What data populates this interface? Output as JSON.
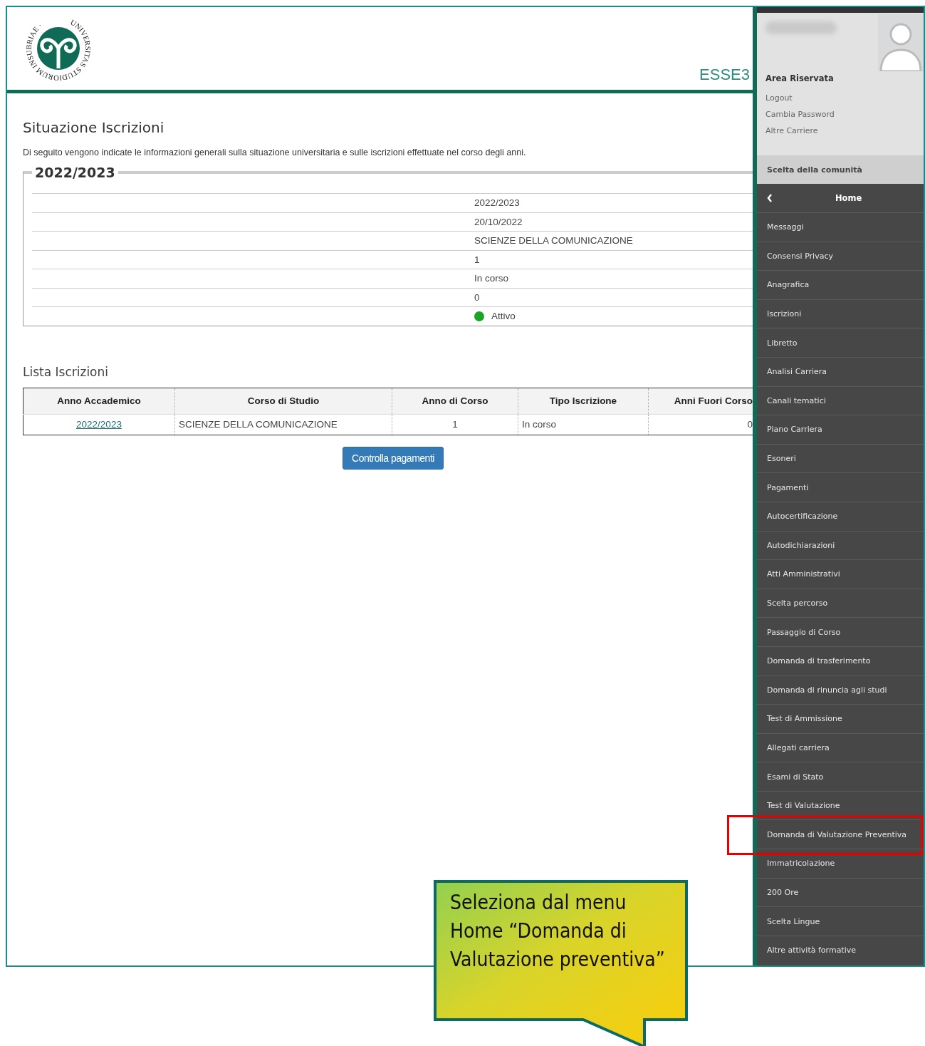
{
  "header": {
    "logo_motto": "UNIVERSITAS STUDIORUM INSUBRIAE ·",
    "app_name": "ESSE3"
  },
  "page": {
    "title": "Situazione Iscrizioni",
    "intro": "Di seguito vengono indicate le informazioni generali sulla situazione universitaria e sulle iscrizioni effettuate nel corso degli anni.",
    "year_box": {
      "legend": "2022/2023",
      "rows": [
        {
          "value": "2022/2023"
        },
        {
          "value": "20/10/2022"
        },
        {
          "value": "SCIENZE DELLA COMUNICAZIONE"
        },
        {
          "value": "1"
        },
        {
          "value": "In corso"
        },
        {
          "value": "0"
        },
        {
          "value": "Attivo",
          "color": "#1aa526"
        }
      ]
    },
    "list_title": "Lista Iscrizioni",
    "table": {
      "columns": [
        "Anno Accademico",
        "Corso di Studio",
        "Anno di Corso",
        "Tipo Iscrizione",
        "Anni Fuori Corso"
      ],
      "rows": [
        [
          "2022/2023",
          "SCIENZE DELLA COMUNICAZIONE",
          "1",
          "In corso",
          "0"
        ]
      ]
    },
    "button": "Controlla pagamenti"
  },
  "sidebar": {
    "area_title": "Area Riservata",
    "links": [
      "Logout",
      "Cambia Password",
      "Altre Carriere"
    ],
    "community": "Scelta della comunità",
    "menu_title": "Home",
    "items": [
      {
        "label": "Messaggi",
        "highlighted": false
      },
      {
        "label": "Consensi Privacy",
        "highlighted": false
      },
      {
        "label": "Anagrafica",
        "highlighted": false
      },
      {
        "label": "Iscrizioni",
        "highlighted": false
      },
      {
        "label": "Libretto",
        "highlighted": false
      },
      {
        "label": "Analisi Carriera",
        "highlighted": false
      },
      {
        "label": "Canali tematici",
        "highlighted": false
      },
      {
        "label": "Piano Carriera",
        "highlighted": false
      },
      {
        "label": "Esoneri",
        "highlighted": false
      },
      {
        "label": "Pagamenti",
        "highlighted": false
      },
      {
        "label": "Autocertificazione",
        "highlighted": false
      },
      {
        "label": "Autodichiarazioni",
        "highlighted": false
      },
      {
        "label": "Atti Amministrativi",
        "highlighted": false
      },
      {
        "label": "Scelta percorso",
        "highlighted": false
      },
      {
        "label": "Passaggio di Corso",
        "highlighted": false
      },
      {
        "label": "Domanda di trasferimento",
        "highlighted": false
      },
      {
        "label": "Domanda di rinuncia agli studi",
        "highlighted": false
      },
      {
        "label": "Test di Ammissione",
        "highlighted": false
      },
      {
        "label": "Allegati carriera",
        "highlighted": false
      },
      {
        "label": "Esami di Stato",
        "highlighted": false
      },
      {
        "label": "Test di Valutazione",
        "highlighted": false
      },
      {
        "label": "Domanda di Valutazione Preventiva",
        "highlighted": true
      },
      {
        "label": "Immatricolazione",
        "highlighted": false
      },
      {
        "label": "200 Ore",
        "highlighted": false
      },
      {
        "label": "Scelta Lingue",
        "highlighted": false
      },
      {
        "label": "Altre attività formative",
        "highlighted": false
      }
    ]
  },
  "callout": {
    "text": "Seleziona dal menu Home “Domanda di Valutazione preventiva”"
  }
}
